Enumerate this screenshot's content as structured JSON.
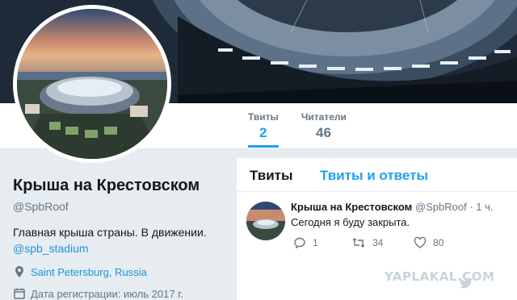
{
  "stats": [
    {
      "label": "Твиты",
      "value": "2"
    },
    {
      "label": "Читатели",
      "value": "46"
    }
  ],
  "profile": {
    "name": "Крыша на Крестовском",
    "handle": "@SpbRoof",
    "bio": "Главная крыша страны. В движении.",
    "bio_link": "@spb_stadium",
    "location": "Saint Petersburg, Russia",
    "joined": "Дата регистрации: июль 2017 г."
  },
  "tabs": {
    "tweets": "Твиты",
    "tweets_replies": "Твиты и ответы"
  },
  "tweet": {
    "name": "Крыша на Крестовском",
    "handle": "@SpbRoof",
    "sep": "·",
    "time": "1 ч.",
    "text": "Сегодня я буду закрыта.",
    "replies": "1",
    "retweets": "34",
    "likes": "80"
  },
  "watermark": "YAPLAKAL.COM",
  "colors": {
    "accent": "#1da1f2",
    "muted": "#657786",
    "text": "#14171a"
  }
}
